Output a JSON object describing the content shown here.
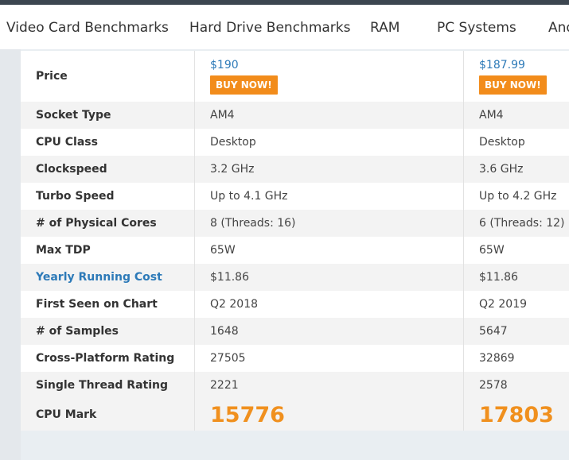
{
  "nav": {
    "items": [
      "Video Card Benchmarks",
      "Hard Drive Benchmarks",
      "RAM",
      "PC Systems",
      "And"
    ]
  },
  "price": {
    "label": "Price",
    "a": "$190",
    "b": "$187.99",
    "buy_label": "BUY NOW!"
  },
  "rows": [
    {
      "label": "Socket Type",
      "a": "AM4",
      "b": "AM4"
    },
    {
      "label": "CPU Class",
      "a": "Desktop",
      "b": "Desktop"
    },
    {
      "label": "Clockspeed",
      "a": "3.2 GHz",
      "b": "3.6 GHz"
    },
    {
      "label": "Turbo Speed",
      "a": "Up to 4.1 GHz",
      "b": "Up to 4.2 GHz"
    },
    {
      "label": "# of Physical Cores",
      "a": "8 (Threads: 16)",
      "b": "6 (Threads: 12)"
    },
    {
      "label": "Max TDP",
      "a": "65W",
      "b": "65W"
    },
    {
      "label": "Yearly Running Cost",
      "a": "$11.86",
      "b": "$11.86"
    },
    {
      "label": "First Seen on Chart",
      "a": "Q2 2018",
      "b": "Q2 2019"
    },
    {
      "label": "# of Samples",
      "a": "1648",
      "b": "5647"
    },
    {
      "label": "Cross-Platform Rating",
      "a": "27505",
      "b": "32869"
    },
    {
      "label": "Single Thread Rating",
      "a": "2221",
      "b": "2578"
    }
  ],
  "cpu_mark": {
    "label": "CPU Mark",
    "a": "15776",
    "b": "17803"
  },
  "colors": {
    "accent_orange": "#f28c1b",
    "link_blue": "#2d7ab8",
    "mark_orange": "#f0901e"
  }
}
